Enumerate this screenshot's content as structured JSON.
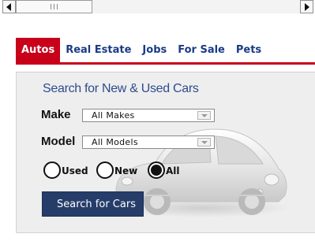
{
  "scrollbar": {
    "left_icon": "arrow-left-icon",
    "right_icon": "arrow-right-icon",
    "grip_icon": "grip-icon"
  },
  "tabs": [
    {
      "label": "Autos",
      "active": true
    },
    {
      "label": "Real Estate",
      "active": false
    },
    {
      "label": "Jobs",
      "active": false
    },
    {
      "label": "For Sale",
      "active": false
    },
    {
      "label": "Pets",
      "active": false
    }
  ],
  "search": {
    "title": "Search for New & Used Cars",
    "make_label": "Make",
    "make_value": "All Makes",
    "model_label": "Model",
    "model_value": "All Models",
    "condition_options": [
      {
        "label": "Used",
        "selected": false
      },
      {
        "label": "New",
        "selected": false
      },
      {
        "label": "All",
        "selected": true
      }
    ],
    "button_label": "Search for Cars",
    "background_image": "car-image"
  },
  "colors": {
    "active_tab": "#c8001a",
    "tab_text": "#1a3b86",
    "panel_background": "#eeeeee",
    "title_text": "#2d4c8c",
    "button": "#263d6a"
  }
}
